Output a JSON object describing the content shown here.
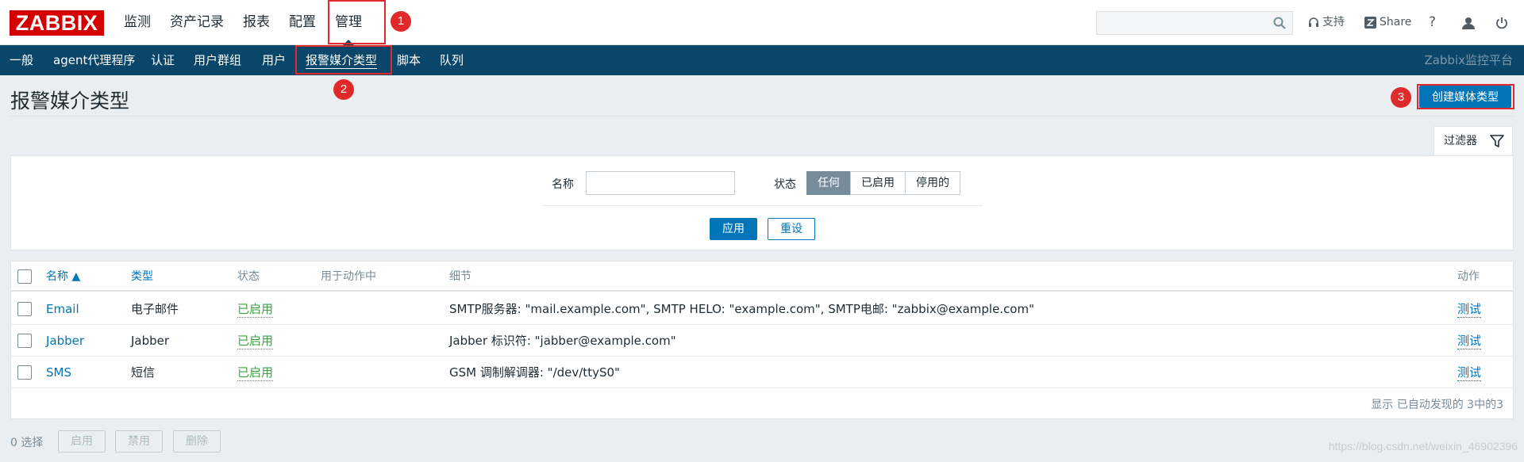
{
  "header": {
    "logo": "ZABBIX",
    "nav": [
      "监测",
      "资产记录",
      "报表",
      "配置",
      "管理"
    ],
    "selected_nav": "管理",
    "search_placeholder": "",
    "support": "支持",
    "share": "Share",
    "help": "?"
  },
  "subnav": {
    "items": [
      "一般",
      "agent代理程序",
      "认证",
      "用户群组",
      "用户",
      "报警媒介类型",
      "脚本",
      "队列"
    ],
    "selected": "报警媒介类型",
    "brand": "Zabbix监控平台"
  },
  "annotations": [
    "1",
    "2",
    "3"
  ],
  "page": {
    "title": "报警媒介类型",
    "create_button": "创建媒体类型"
  },
  "filter": {
    "tab_label": "过滤器",
    "name_label": "名称",
    "name_value": "",
    "status_label": "状态",
    "status_options": [
      "任何",
      "已启用",
      "停用的"
    ],
    "status_selected": "任何",
    "apply": "应用",
    "reset": "重设"
  },
  "table": {
    "columns": [
      "名称 ▲",
      "类型",
      "状态",
      "用于动作中",
      "细节",
      "动作"
    ],
    "rows": [
      {
        "name": "Email",
        "type": "电子邮件",
        "status": "已启用",
        "used_in_actions": "",
        "details": "SMTP服务器: \"mail.example.com\", SMTP HELO: \"example.com\", SMTP电邮: \"zabbix@example.com\"",
        "action": "测试"
      },
      {
        "name": "Jabber",
        "type": "Jabber",
        "status": "已启用",
        "used_in_actions": "",
        "details": "Jabber 标识符: \"jabber@example.com\"",
        "action": "测试"
      },
      {
        "name": "SMS",
        "type": "短信",
        "status": "已启用",
        "used_in_actions": "",
        "details": "GSM 调制解调器: \"/dev/ttyS0\"",
        "action": "测试"
      }
    ],
    "footer": "显示 已自动发现的 3中的3"
  },
  "bottom": {
    "selected_count": "0 选择",
    "buttons": [
      "启用",
      "禁用",
      "删除"
    ]
  },
  "watermark": "https://blog.csdn.net/weixin_46902396",
  "colors": {
    "accent": "#0275b8",
    "subnav_bg": "#0a466a",
    "logo": "#d40000",
    "enabled": "#429e47",
    "highlight": "#e0292b"
  }
}
